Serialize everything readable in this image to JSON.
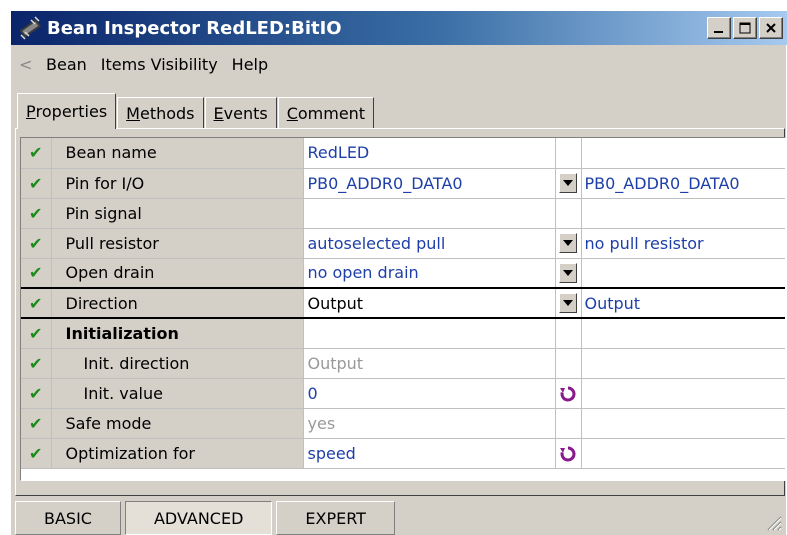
{
  "window": {
    "title": "Bean Inspector RedLED:BitIO"
  },
  "titlebar_buttons": {
    "minimize": "_",
    "maximize": "□",
    "close": "X"
  },
  "menu": {
    "back": "<",
    "items": [
      "Bean",
      "Items Visibility",
      "Help"
    ]
  },
  "tabs": [
    {
      "label": "Properties",
      "underline": "P",
      "rest": "roperties"
    },
    {
      "label": "Methods",
      "underline": "M",
      "rest": "ethods"
    },
    {
      "label": "Events",
      "underline": "E",
      "rest": "vents"
    },
    {
      "label": "Comment",
      "underline": "C",
      "rest": "omment"
    }
  ],
  "properties": [
    {
      "name": "Bean name",
      "value": "RedLED",
      "original": ""
    },
    {
      "name": "Pin for I/O",
      "value": "PB0_ADDR0_DATA0",
      "original": "PB0_ADDR0_DATA0"
    },
    {
      "name": "Pin signal",
      "value": "",
      "original": ""
    },
    {
      "name": "Pull resistor",
      "value": "autoselected pull",
      "original": "no pull resistor"
    },
    {
      "name": "Open drain",
      "value": "no open drain",
      "original": ""
    },
    {
      "name": "Direction",
      "value": "Output",
      "original": "Output"
    },
    {
      "name": "Initialization",
      "value": "",
      "original": ""
    },
    {
      "name": "Init. direction",
      "value": "Output",
      "original": ""
    },
    {
      "name": "Init. value",
      "value": "0",
      "original": ""
    },
    {
      "name": "Safe mode",
      "value": "yes",
      "original": ""
    },
    {
      "name": "Optimization for",
      "value": "speed",
      "original": ""
    }
  ],
  "levels": [
    "BASIC",
    "ADVANCED",
    "EXPERT"
  ],
  "colors": {
    "title_start": "#0a246a",
    "title_end": "#a6caf0",
    "value_text": "#1e3fa8",
    "check": "#1a8a1a",
    "reset": "#8a1a8a"
  }
}
